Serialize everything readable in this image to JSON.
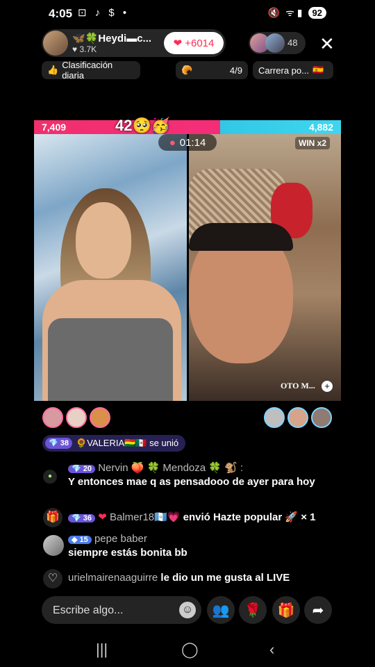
{
  "status": {
    "time": "4:05",
    "left_icons": "⊡ ♪ $ •",
    "signal": "ᯤ ▮",
    "battery": "92"
  },
  "host": {
    "name": "🦋🍀Heydi▬c...",
    "likes": "♥ 3.7K",
    "follow_label": "+6014",
    "viewer_count": "48"
  },
  "pills": {
    "ranking": "Clasificación diaria",
    "progress": "4/9",
    "career": "Carrera po..."
  },
  "battle": {
    "score_left": "7,409",
    "score_right": "4,882",
    "combo": "42🥺🥳",
    "timer": "01:14",
    "multiplier": "WIN x2",
    "guest_name": "OTO M..."
  },
  "joined": {
    "level": "38",
    "text": "🌻VALERIA🇧🇴🇲🇽 se unió"
  },
  "chat": [
    {
      "level": "20",
      "user": "Nervin 🍑 🍀 Mendoza 🍀 🐒 :",
      "text": "Y entonces mae q as pensadooo de ayer para hoy"
    },
    {
      "level": "36",
      "user": "Balmer18🇬🇹💗",
      "text": "envió Hazte popular 🚀 × 1"
    },
    {
      "level": "15",
      "user": "pepe baber",
      "text": "siempre estás bonita bb"
    },
    {
      "user": "urielmairenaaguirre",
      "text": "le dio un me gusta al LIVE"
    }
  ],
  "composer": {
    "placeholder": "Escribe algo..."
  },
  "colors": {
    "left_team": "#f0306d",
    "right_team": "#30c8e6",
    "accent": "#fe2c55"
  }
}
